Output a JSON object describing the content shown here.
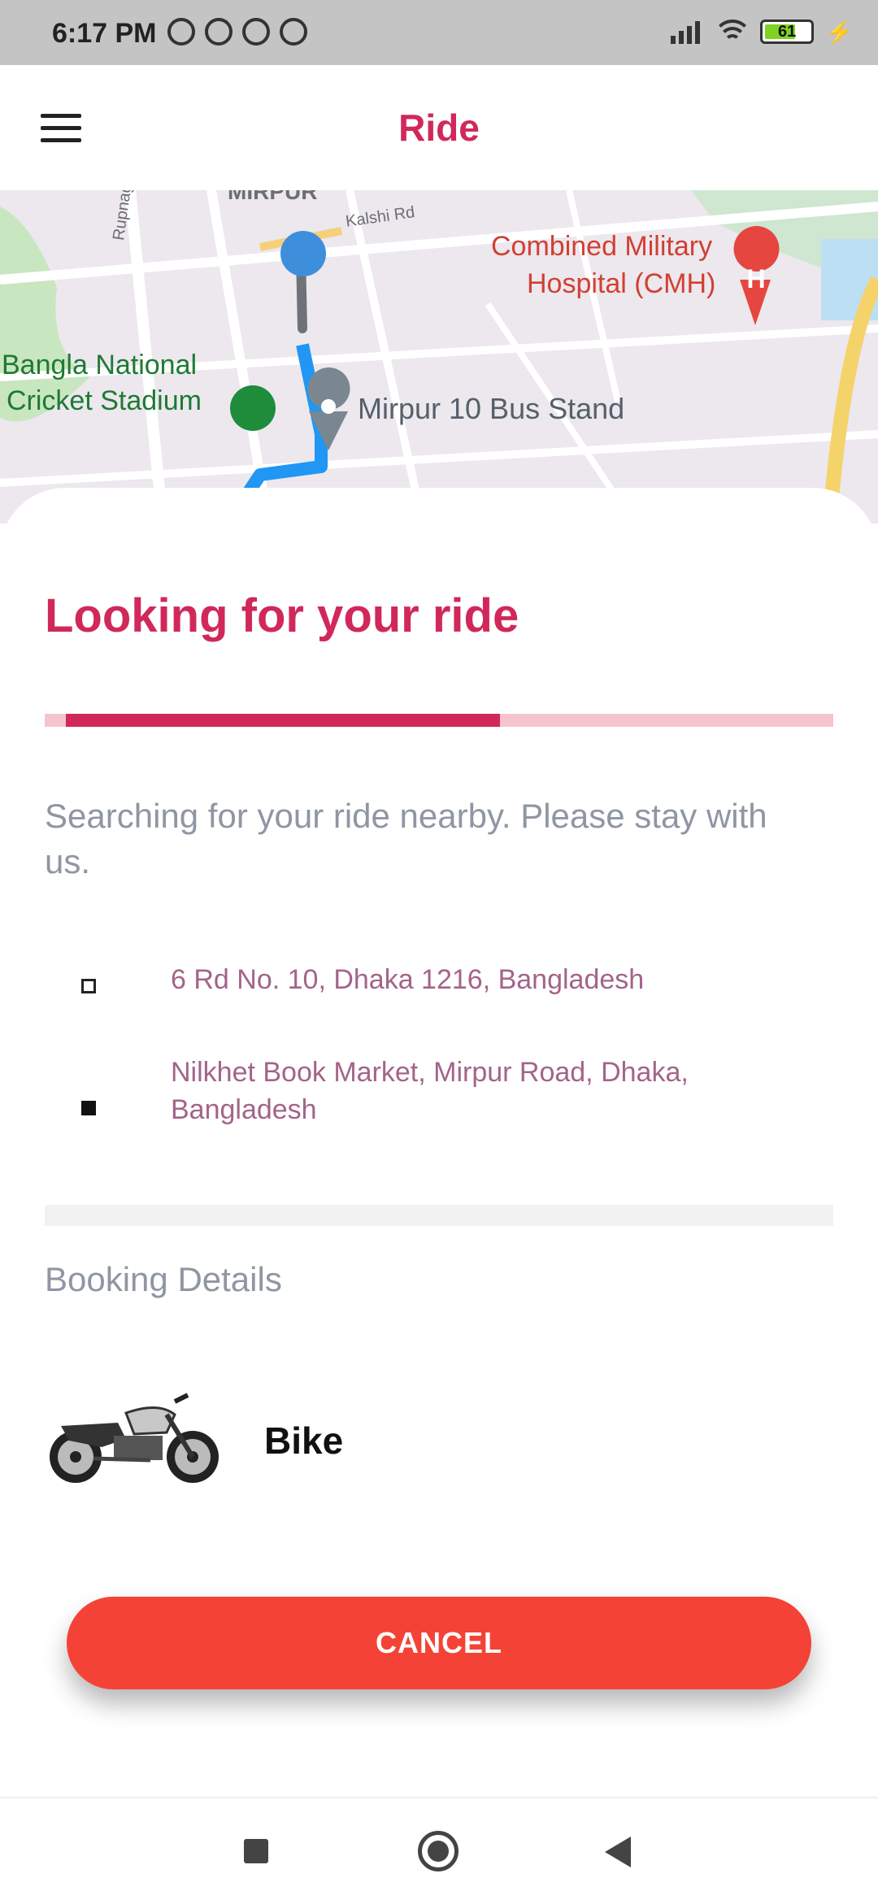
{
  "status_bar": {
    "time": "6:17 PM",
    "battery_level": "61",
    "icons": [
      "mute-icon",
      "alarm-icon",
      "data-saver-icon",
      "data-saver-icon",
      "signal-icon",
      "wifi-icon",
      "battery-icon",
      "charging-icon"
    ]
  },
  "app_bar": {
    "title": "Ride",
    "menu_icon": "hamburger-menu-icon"
  },
  "map": {
    "labels": {
      "area": "MIRPUR",
      "road_kalshi": "Kalshi Rd",
      "road_rupnagar": "Rupnagar Rd",
      "hospital_line1": "Combined Military",
      "hospital_line2": "Hospital (CMH)",
      "stadium_line1": "Bangla National",
      "stadium_line2": "Cricket Stadium",
      "bus_stand": "Mirpur 10 Bus Stand"
    },
    "colors": {
      "route": "#2196f3",
      "origin_pin": "#3d8fdc",
      "hospital": "#e5463f",
      "stadium": "#1e8c3a"
    }
  },
  "ride": {
    "title": "Looking for your ride",
    "progress_fraction": 0.55,
    "description": "Searching for your ride nearby. Please stay with us.",
    "pickup_address": "6 Rd No. 10, Dhaka 1216, Bangladesh",
    "dropoff_address": "Nilkhet Book Market, Mirpur Road, Dhaka, Bangladesh",
    "booking_details_label": "Booking Details",
    "vehicle_type": "Bike",
    "cancel_label": "CANCEL"
  },
  "colors": {
    "accent": "#d1285a",
    "progress_track": "#f6c4cf",
    "cancel_button": "#f44336",
    "address_text": "#a3648a",
    "muted_text": "#8f96a3"
  },
  "nav_bar": {
    "icons": [
      "recents-icon",
      "home-icon",
      "back-icon"
    ]
  }
}
